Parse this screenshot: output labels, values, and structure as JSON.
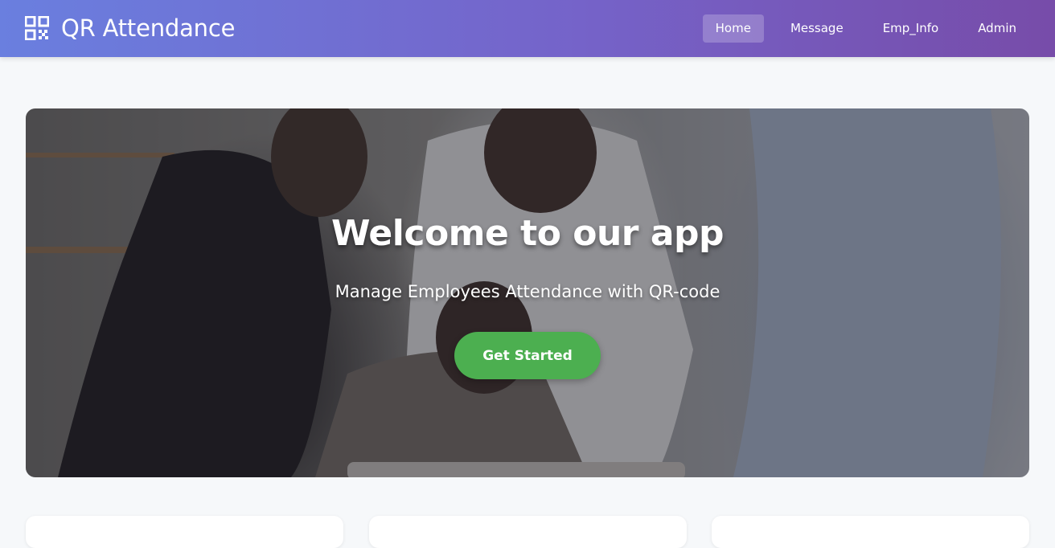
{
  "brand": {
    "name": "QR Attendance",
    "icon": "qr-code-icon"
  },
  "nav": {
    "items": [
      {
        "label": "Home",
        "active": true
      },
      {
        "label": "Message",
        "active": false
      },
      {
        "label": "Emp_Info",
        "active": false
      },
      {
        "label": "Admin",
        "active": false
      }
    ]
  },
  "hero": {
    "title": "Welcome to our app",
    "subtitle": "Manage Employees Attendance with QR-code",
    "cta_label": "Get Started"
  },
  "colors": {
    "nav_gradient_start": "#6a7fdf",
    "nav_gradient_end": "#774ca9",
    "cta": "#4caf50",
    "page_bg": "#f6f8fa"
  }
}
